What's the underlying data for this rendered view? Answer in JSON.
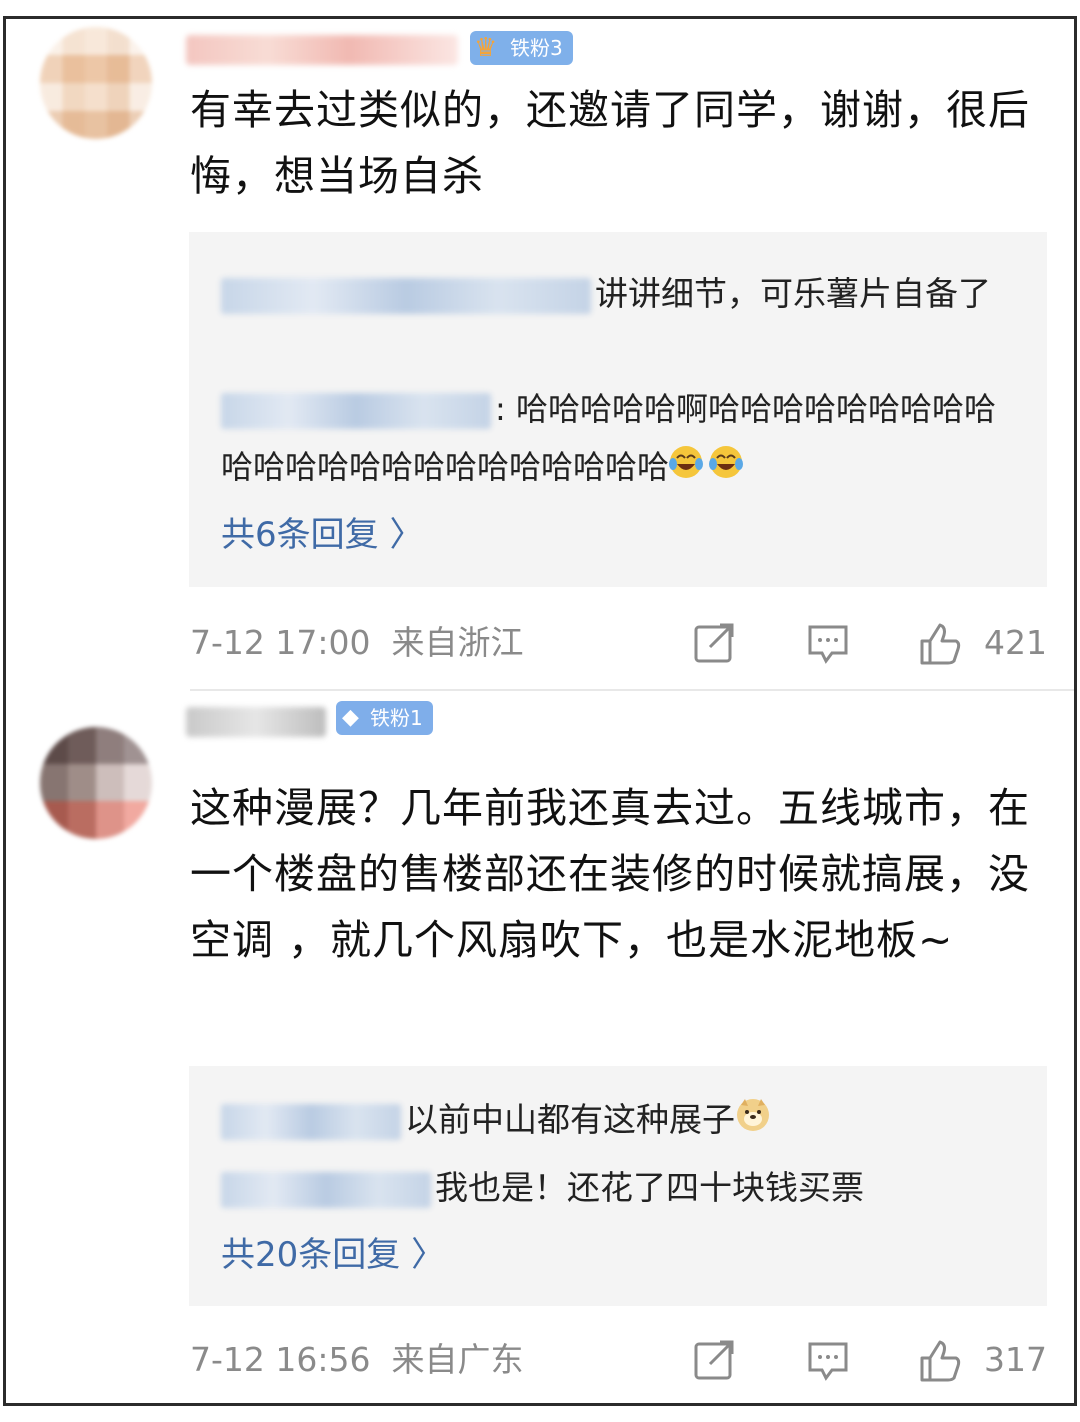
{
  "comments": [
    {
      "badge": "铁粉3",
      "text": "有幸去过类似的，还邀请了同学，谢谢，很后悔，想当场自杀",
      "replies": [
        {
          "text": "讲讲细节，可乐薯片自备了"
        },
        {
          "text": ": 哈哈哈哈哈啊哈哈哈哈哈哈哈哈哈哈哈哈哈哈哈哈哈哈哈哈哈哈哈",
          "emoji": "laugh-cry-emoji"
        }
      ],
      "more_replies": "共6条回复 〉",
      "date": "7-12 17:00",
      "location": "来自浙江",
      "likes": "421"
    },
    {
      "badge": "铁粉1",
      "text": "这种漫展？几年前我还真去过。五线城市，在一个楼盘的售楼部还在装修的时候就搞展，没空调 ，就几个风扇吹下，也是水泥地板~",
      "replies": [
        {
          "text": "以前中山都有这种展子",
          "emoji": "doge-emoji"
        },
        {
          "text": "我也是！还花了四十块钱买票"
        }
      ],
      "more_replies": "共20条回复 〉",
      "date": "7-12 16:56",
      "location": "来自广东",
      "likes": "317"
    }
  ],
  "colors": {
    "link": "#3f6aa6",
    "badge": "#7fb0ea",
    "meta": "#8a8a8a",
    "reply_bg": "#f4f4f4"
  }
}
